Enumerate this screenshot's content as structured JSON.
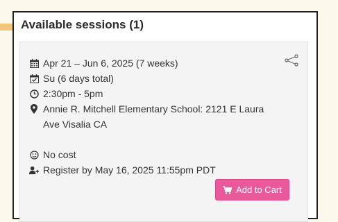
{
  "heading": "Available sessions (1)",
  "session": {
    "dates": "Apr 21 – Jun 6, 2025 (7 weeks)",
    "days": "Su (6 days total)",
    "time": "2:30pm - 5pm",
    "location": "Annie R. Mitchell Elementary School: 2121 E Laura Ave Visalia CA",
    "cost": "No cost",
    "register_by": "Register by May 16, 2025 11:55pm PDT"
  },
  "add_to_cart_label": "Add to Cart",
  "icons": {
    "dates": "calendar-icon",
    "days": "calendar-check-icon",
    "time": "clock-icon",
    "location": "map-pin-icon",
    "cost": "smile-icon",
    "register": "user-plus-icon",
    "share": "share-icon",
    "cart": "shopping-cart-icon"
  },
  "colors": {
    "accent_button": "#e85a9b",
    "card_background": "#f4f4f4",
    "page_background": "#fdf8ec"
  }
}
